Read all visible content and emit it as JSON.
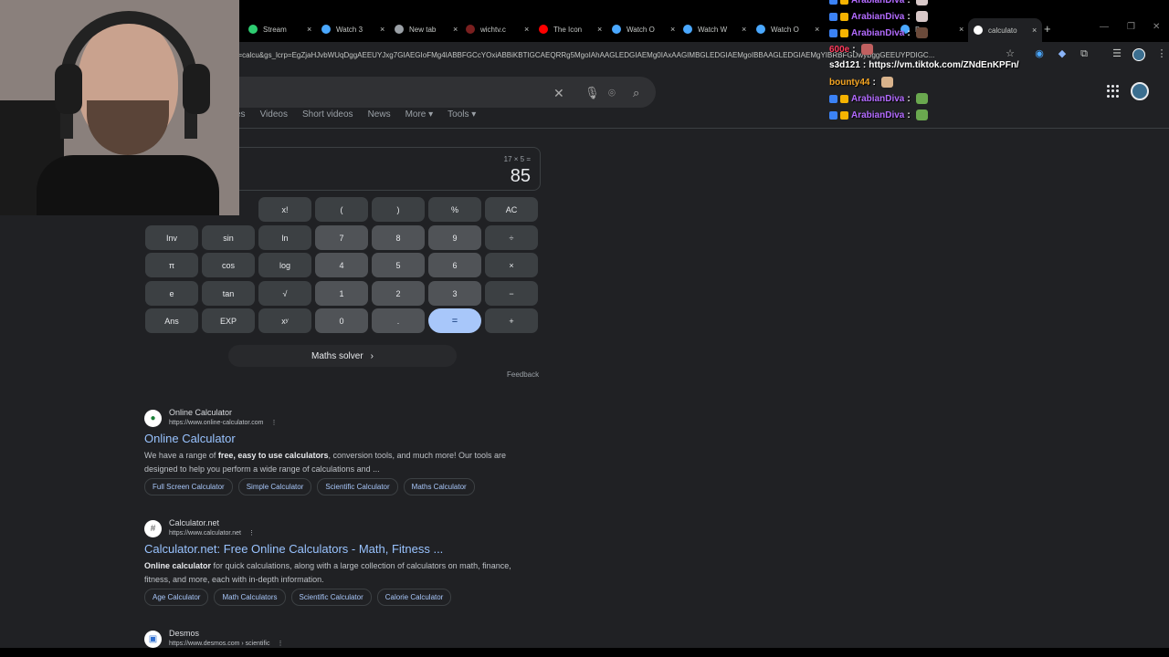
{
  "browser": {
    "tabs": [
      {
        "label": "Stream",
        "color": "#2ecc71"
      },
      {
        "label": "Watch 3",
        "color": "#4aa8ff"
      },
      {
        "label": "New tab",
        "color": "#9aa0a6"
      },
      {
        "label": "wichtv.c",
        "color": "#7a1f1f"
      },
      {
        "label": "The Icon",
        "color": "#ff0000"
      },
      {
        "label": "Watch O",
        "color": "#4aa8ff"
      },
      {
        "label": "Watch W",
        "color": "#4aa8ff"
      },
      {
        "label": "Watch O",
        "color": "#4aa8ff"
      },
      {
        "label": "Be",
        "color": "#4aa8ff"
      }
    ],
    "active_tab": {
      "label": "calculato",
      "color": "#ffffff"
    },
    "tab_close": "×",
    "new_tab": "+",
    "url": "q=calcu&gs_lcrp=EgZjaHJvbWUqDggAEEUYJxg7GIAEGIoFMg4IABBFGCcYOxiABBiKBTIGCAEQRRg5MgoIAhAAGLEDGIAEMg0IAxAAGIMBGLEDGIAEMgoIBBAAGLEDGIAEMgYIBRBFGDwyBggGEEUYPDIGC..."
  },
  "search": {
    "clear_icon": "✕",
    "nav_tabs": [
      "es",
      "Videos",
      "Short videos",
      "News",
      "More ▾",
      "Tools ▾"
    ]
  },
  "calculator": {
    "expression": "17 × 5 =",
    "result": "85",
    "keys": [
      [
        "",
        "x!",
        "(",
        ")",
        "%",
        "AC"
      ],
      [
        "Inv",
        "sin",
        "ln",
        "7",
        "8",
        "9",
        "÷"
      ],
      [
        "π",
        "cos",
        "log",
        "4",
        "5",
        "6",
        "×"
      ],
      [
        "e",
        "tan",
        "√",
        "1",
        "2",
        "3",
        "−"
      ],
      [
        "Ans",
        "EXP",
        "xʸ",
        "0",
        ".",
        "=",
        "+"
      ]
    ],
    "maths_solver": "Maths solver",
    "feedback": "Feedback"
  },
  "results": [
    {
      "site": "Online Calculator",
      "url": "https://www.online-calculator.com",
      "title": "Online Calculator",
      "snippet_html": "We have a range of <b>free, easy to use calculators</b>, conversion tools, and much more! Our tools are designed to help you perform a wide range of calculations and ...",
      "chips": [
        "Full Screen Calculator",
        "Simple Calculator",
        "Scientific Calculator",
        "Maths Calculator"
      ]
    },
    {
      "site": "Calculator.net",
      "url": "https://www.calculator.net",
      "title": "Calculator.net: Free Online Calculators - Math, Fitness ...",
      "snippet_html": "<b>Online calculator</b> for quick calculations, along with a large collection of calculators on math, finance, fitness, and more, each with in-depth information.",
      "chips": [
        "Age Calculator",
        "Math Calculators",
        "Scientific Calculator",
        "Calorie Calculator"
      ]
    },
    {
      "site": "Desmos",
      "url": "https://www.desmos.com › scientific",
      "title": "",
      "snippet_html": "",
      "chips": []
    }
  ],
  "result_menu": "⋮",
  "chat": [
    {
      "user": "ArabianDiva",
      "color": "#b36bff",
      "message": "",
      "emote": "#d8c8c8",
      "badge": "#3b82f6"
    },
    {
      "user": "ArabianDiva",
      "color": "#b36bff",
      "message": "",
      "emote": "#d8c8c8",
      "badge": "#3b82f6"
    },
    {
      "user": "ArabianDiva",
      "color": "#b36bff",
      "message": "",
      "emote": "#6b4a3a",
      "badge": "#3b82f6"
    },
    {
      "user": "600e",
      "color": "#ff3b5c",
      "message": "",
      "emote": "#c06060",
      "badge": ""
    },
    {
      "user": "s3d121",
      "color": "#ffffff",
      "message": "https://vm.tiktok.com/ZNdEnKPFn/",
      "emote": "",
      "badge": ""
    },
    {
      "user": "bounty44",
      "color": "#f5a623",
      "message": "",
      "emote": "#d9b38c",
      "badge": ""
    },
    {
      "user": "ArabianDiva",
      "color": "#b36bff",
      "message": "",
      "emote": "#6aa84f",
      "badge": "#3b82f6"
    },
    {
      "user": "ArabianDiva",
      "color": "#b36bff",
      "message": "",
      "emote": "#6aa84f",
      "badge": "#3b82f6"
    }
  ]
}
